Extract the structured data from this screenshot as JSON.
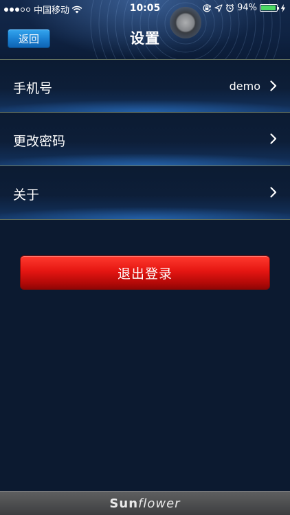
{
  "status_bar": {
    "signal_strength": 3,
    "signal_max": 5,
    "carrier": "中国移动",
    "wifi_icon": "wifi-icon",
    "time": "10:05",
    "right_icons": [
      "orientation-lock-icon",
      "location-arrow-icon",
      "alarm-icon"
    ],
    "battery_percent": "94%",
    "battery_level": 0.94,
    "battery_color": "#4cd964",
    "charging_icon": "lightning-icon"
  },
  "nav": {
    "back_label": "返回",
    "title": "设置"
  },
  "settings": {
    "items": [
      {
        "label": "手机号",
        "value": "demo"
      },
      {
        "label": "更改密码",
        "value": ""
      },
      {
        "label": "关于",
        "value": ""
      }
    ]
  },
  "actions": {
    "logout_label": "退出登录",
    "logout_color": "#e51612"
  },
  "footer": {
    "brand_part1": "Sun",
    "brand_part2": "flower"
  },
  "colors": {
    "background": "#0c1a30",
    "accent_blue": "#1a7fd1",
    "divider": "#6f7d66"
  }
}
